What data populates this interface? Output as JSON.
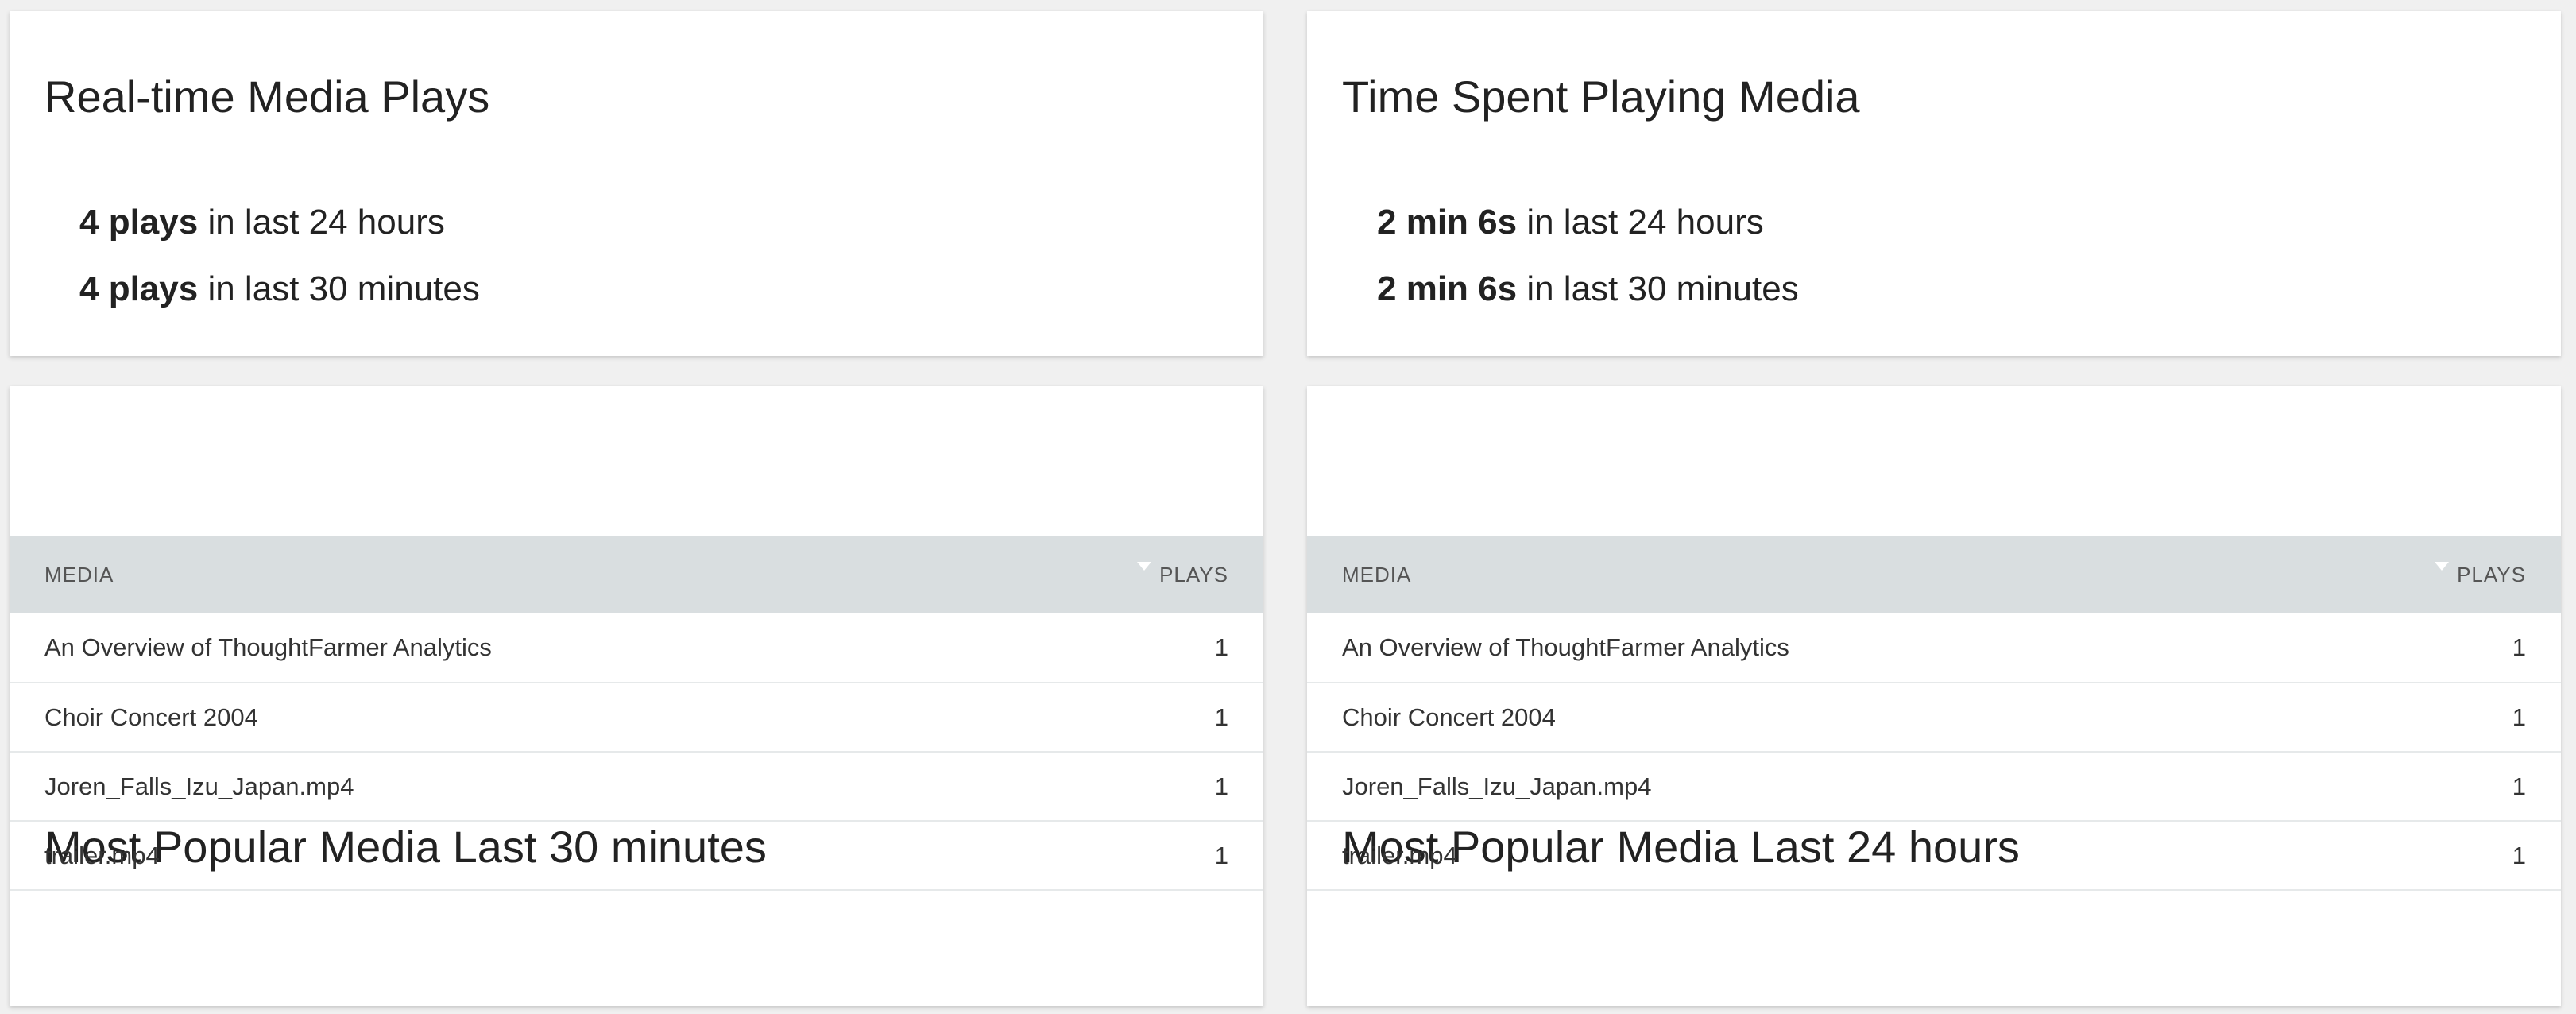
{
  "realtime_plays": {
    "title": "Real-time Media Plays",
    "stats": [
      {
        "value": "4 plays",
        "label": " in last 24 hours"
      },
      {
        "value": "4 plays",
        "label": " in last 30 minutes"
      }
    ]
  },
  "time_spent": {
    "title": "Time Spent Playing Media",
    "stats": [
      {
        "value": "2 min 6s",
        "label": " in last 24 hours"
      },
      {
        "value": "2 min 6s",
        "label": " in last 30 minutes"
      }
    ]
  },
  "popular_30min": {
    "title": "Most Popular Media Last 30 minutes",
    "columns": {
      "media": "MEDIA",
      "plays": "PLAYS"
    },
    "rows": [
      {
        "media": "An Overview of ThoughtFarmer Analytics",
        "plays": "1"
      },
      {
        "media": "Choir Concert 2004",
        "plays": "1"
      },
      {
        "media": "Joren_Falls_Izu_Japan.mp4",
        "plays": "1"
      },
      {
        "media": "trailer.mp4",
        "plays": "1"
      }
    ]
  },
  "popular_24h": {
    "title": "Most Popular Media Last 24 hours",
    "columns": {
      "media": "MEDIA",
      "plays": "PLAYS"
    },
    "rows": [
      {
        "media": "An Overview of ThoughtFarmer Analytics",
        "plays": "1"
      },
      {
        "media": "Choir Concert 2004",
        "plays": "1"
      },
      {
        "media": "Joren_Falls_Izu_Japan.mp4",
        "plays": "1"
      },
      {
        "media": "trailer.mp4",
        "plays": "1"
      }
    ]
  },
  "icons": {
    "sort": "sort-descending-icon"
  },
  "colors": {
    "page_background": "#f0f0f0",
    "card_background": "#ffffff",
    "table_header_background": "#d9dee0",
    "row_divider": "#e6e9ea"
  }
}
